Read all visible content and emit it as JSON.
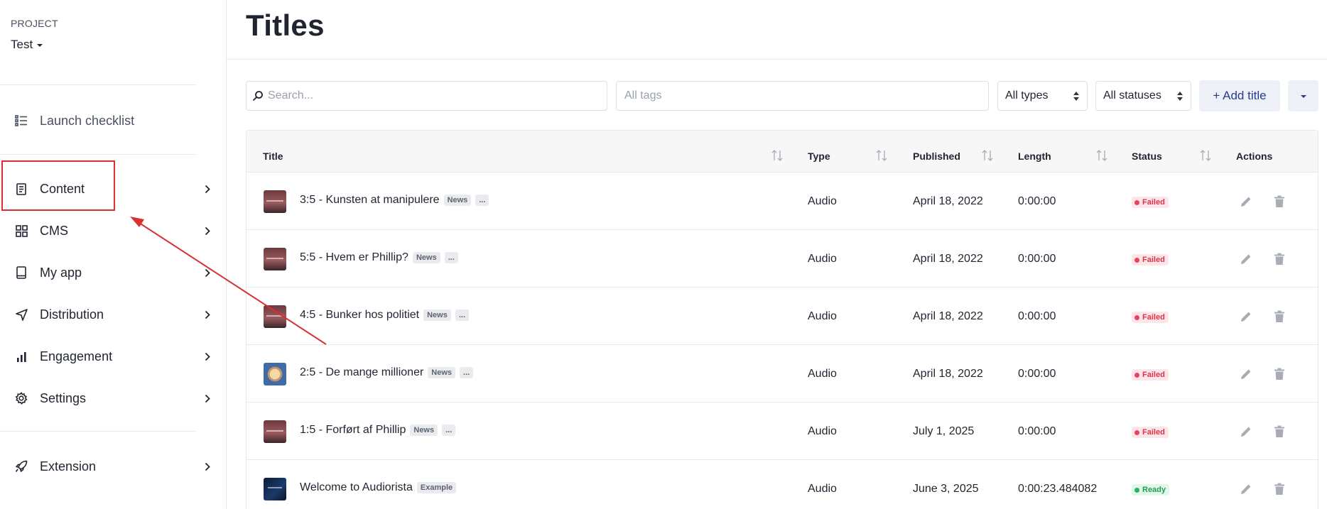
{
  "sidebar": {
    "project_label": "PROJECT",
    "project_name": "Test",
    "items": [
      {
        "label": "Launch checklist",
        "icon": "checklist-icon"
      },
      {
        "label": "Content",
        "icon": "document-icon"
      },
      {
        "label": "CMS",
        "icon": "grid-icon"
      },
      {
        "label": "My app",
        "icon": "tablet-icon"
      },
      {
        "label": "Distribution",
        "icon": "send-icon"
      },
      {
        "label": "Engagement",
        "icon": "bar-chart-icon"
      },
      {
        "label": "Settings",
        "icon": "gear-icon"
      },
      {
        "label": "Extension",
        "icon": "rocket-icon"
      }
    ]
  },
  "header": {
    "title": "Titles"
  },
  "toolbar": {
    "search_placeholder": "Search...",
    "tags_placeholder": "All tags",
    "types_value": "All types",
    "statuses_value": "All statuses",
    "add_label": "+ Add title"
  },
  "table": {
    "columns": [
      "Title",
      "Type",
      "Published",
      "Length",
      "Status",
      "Actions"
    ],
    "rows": [
      {
        "title": "3:5 - Kunsten at manipulere",
        "tags": [
          "News",
          "..."
        ],
        "type": "Audio",
        "published": "April 18, 2022",
        "length": "0:00:00",
        "status": "Failed",
        "thumb": "red"
      },
      {
        "title": "5:5 - Hvem er Phillip?",
        "tags": [
          "News",
          "..."
        ],
        "type": "Audio",
        "published": "April 18, 2022",
        "length": "0:00:00",
        "status": "Failed",
        "thumb": "red"
      },
      {
        "title": "4:5 - Bunker hos politiet",
        "tags": [
          "News",
          "..."
        ],
        "type": "Audio",
        "published": "April 18, 2022",
        "length": "0:00:00",
        "status": "Failed",
        "thumb": "red"
      },
      {
        "title": "2:5 - De mange millioner",
        "tags": [
          "News",
          "..."
        ],
        "type": "Audio",
        "published": "April 18, 2022",
        "length": "0:00:00",
        "status": "Failed",
        "thumb": "blue"
      },
      {
        "title": "1:5 - Forført af Phillip",
        "tags": [
          "News",
          "..."
        ],
        "type": "Audio",
        "published": "July 1, 2025",
        "length": "0:00:00",
        "status": "Failed",
        "thumb": "red"
      },
      {
        "title": "Welcome to Audiorista",
        "tags": [
          "Example"
        ],
        "type": "Audio",
        "published": "June 3, 2025",
        "length": "0:00:23.484082",
        "status": "Ready",
        "thumb": "dark"
      }
    ]
  },
  "colors": {
    "annotation": "#d93030",
    "accent": "#2a3a8c",
    "failed": "#d9324a",
    "ready": "#1f9d55"
  }
}
